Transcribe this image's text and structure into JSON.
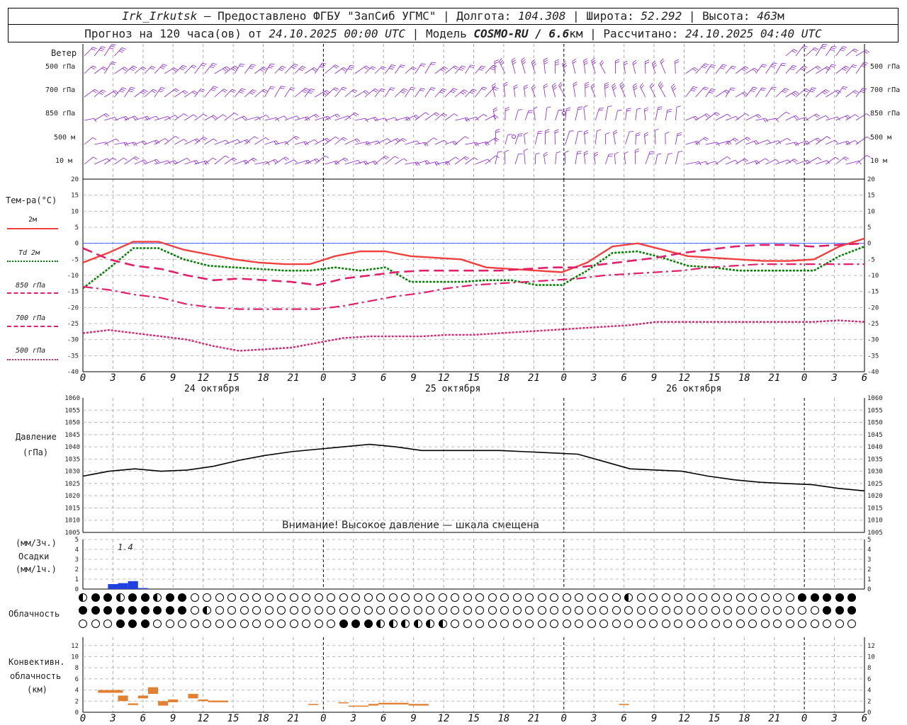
{
  "header": {
    "station": "Irk_Irkutsk",
    "provider": "— Предоставлено ФГБУ \"ЗапСиб УГМС\"",
    "lon_label": "Долгота:",
    "lon": "104.308",
    "lat_label": "Широта:",
    "lat": "52.292",
    "alt_label": "Высота:",
    "alt": "463",
    "alt_unit": "м",
    "forecast_label": "Прогноз на 120 часа(ов) от",
    "forecast_from": "24.10.2025 00:00 UTC",
    "model_label": "Модель",
    "model": "COSMO-RU / 6.6",
    "model_unit": "км",
    "calc_label": "Рассчитано:",
    "calc_time": "24.10.2025 04:40 UTC"
  },
  "wind": {
    "title": "Ветер",
    "levels": [
      "500 гПа",
      "700 гПа",
      "850 гПа",
      "500 м",
      "10 м"
    ]
  },
  "temp": {
    "title": "Тем-ра(°C)",
    "legend": [
      "2м",
      "Td 2м",
      "850 гПа",
      "700 гПа",
      "500 гПа"
    ],
    "colors": {
      "t2m": "#f04040",
      "td2m": "#008000",
      "t850": "#e0206a",
      "t700": "#e0206a",
      "t500": "#e0206a"
    }
  },
  "pressure": {
    "title": "Давление",
    "unit": "(гПа)",
    "warning": "Внимание! Высокое давление — шкала смещена"
  },
  "precip": {
    "unit1": "(мм/3ч.)",
    "title": "Осадки",
    "unit2": "(мм/1ч.)",
    "max_label": "1.4",
    "color": "#2040e0"
  },
  "clouds": {
    "title": "Облачность"
  },
  "conv": {
    "title1": "Конвективн.",
    "title2": "облачность",
    "unit": "(км)",
    "color": "#e08030"
  },
  "axis": {
    "ticks": [
      "0",
      "3",
      "6",
      "9",
      "12",
      "15",
      "18",
      "21",
      "0",
      "3",
      "6",
      "9",
      "12",
      "15",
      "18",
      "21",
      "0",
      "3",
      "6",
      "9",
      "12",
      "15",
      "18",
      "21",
      "0",
      "3",
      "6"
    ],
    "dates": [
      "24 октября",
      "25 октября",
      "26 октября"
    ]
  },
  "chart_data": [
    {
      "type": "line",
      "title": "Тем-ра(°C)",
      "x_hours": [
        0,
        3,
        6,
        9,
        12,
        15,
        18,
        21,
        24,
        27,
        30,
        33,
        36,
        39,
        42,
        45,
        48,
        51,
        54,
        57,
        60,
        63,
        66,
        69,
        72,
        75,
        78
      ],
      "ylim": [
        -40,
        20
      ],
      "series": [
        {
          "name": "2м",
          "values": [
            -6,
            -3,
            0.5,
            0.5,
            -2,
            -3.5,
            -5,
            -6,
            -6.5,
            -6.5,
            -4,
            -2.5,
            -2.5,
            -4,
            -4.5,
            -5,
            -7.5,
            -8,
            -8.5,
            -9,
            -6,
            -1,
            0,
            -2,
            -4,
            -4.5,
            -5,
            -5.5,
            -5.5,
            -5,
            -1,
            1.5
          ]
        },
        {
          "name": "Td 2м",
          "values": [
            -14,
            -8,
            -1.5,
            -1.5,
            -5,
            -7,
            -7.5,
            -8,
            -8.5,
            -8.5,
            -7.5,
            -8.5,
            -7.5,
            -12,
            -12,
            -12,
            -11.5,
            -11.5,
            -13,
            -13,
            -8.5,
            -3,
            -2.5,
            -4.5,
            -7,
            -7.5,
            -8.5,
            -8.5,
            -8.5,
            -8.5,
            -4,
            -1
          ]
        },
        {
          "name": "850 гПа",
          "values": [
            -1.5,
            -5,
            -7,
            -8,
            -10,
            -11.5,
            -11,
            -11.5,
            -12,
            -13,
            -11,
            -10,
            -9,
            -8.5,
            -8.5,
            -8.5,
            -8.5,
            -8,
            -7.5,
            -7.5,
            -6.5,
            -5.5,
            -4.5,
            -3,
            -2,
            -1,
            -0.5,
            -0.5,
            -1,
            -0.5,
            0
          ]
        },
        {
          "name": "700 гПа",
          "values": [
            -13.5,
            -14.5,
            -16,
            -17,
            -19,
            -20,
            -20.5,
            -20.5,
            -20.5,
            -20.5,
            -19.5,
            -18,
            -16.5,
            -15.5,
            -14,
            -13,
            -12.5,
            -12,
            -11.5,
            -11,
            -10,
            -9.5,
            -9,
            -8.5,
            -7.5,
            -7,
            -6.5,
            -6.5,
            -6.5,
            -6.5,
            -6.5
          ]
        },
        {
          "name": "500 гПа",
          "values": [
            -28,
            -27,
            -28,
            -29,
            -30,
            -32,
            -33.5,
            -33,
            -32.5,
            -31,
            -29.5,
            -29,
            -29,
            -29,
            -28.5,
            -28.5,
            -28,
            -27.5,
            -27,
            -26.5,
            -26,
            -25.5,
            -24.5,
            -24.5,
            -24.5,
            -24.5,
            -24.5,
            -24.5,
            -24.5,
            -24,
            -24.5
          ]
        }
      ]
    },
    {
      "type": "line",
      "title": "Давление",
      "ylim": [
        1005,
        1060
      ],
      "series": [
        {
          "name": "Давление",
          "values": [
            1028,
            1030,
            1031,
            1030,
            1030.5,
            1032,
            1034.5,
            1036.5,
            1038,
            1039,
            1040,
            1041,
            1040,
            1038.5,
            1038.5,
            1038.5,
            1038.5,
            1038,
            1037.5,
            1037,
            1034,
            1031,
            1030.5,
            1030,
            1028,
            1026.5,
            1025.5,
            1025,
            1024.5,
            1023,
            1022
          ]
        }
      ]
    },
    {
      "type": "bar",
      "title": "Осадки",
      "ylim": [
        0,
        5
      ],
      "values_by_hour": {
        "2": 0,
        "3": 0.5,
        "4": 0.6,
        "5": 0.8,
        "6": 0.1
      }
    },
    {
      "type": "bar",
      "title": "Конвективн. облачность",
      "ylim": [
        0,
        13
      ],
      "segments_km": [
        [
          1.5,
          4,
          3.5,
          4
        ],
        [
          3.5,
          4.5,
          2,
          3
        ],
        [
          4.5,
          5.5,
          1.3,
          1.6
        ],
        [
          5.5,
          6.5,
          2.5,
          3
        ],
        [
          6.5,
          7.5,
          3.3,
          4.5
        ],
        [
          7.5,
          8.5,
          1.2,
          2
        ],
        [
          8.5,
          9.5,
          1.8,
          2.3
        ],
        [
          10.5,
          11.5,
          2.5,
          3.3
        ],
        [
          11.5,
          12.5,
          2,
          2.3
        ],
        [
          12.5,
          14.5,
          1.8,
          2.1
        ],
        [
          22.5,
          23.5,
          1.3,
          1.5
        ],
        [
          25.5,
          26.5,
          1.6,
          1.8
        ],
        [
          26.5,
          28.5,
          1,
          1.2
        ],
        [
          28.5,
          29.5,
          1.2,
          1.5
        ],
        [
          29.5,
          32.5,
          1.4,
          1.7
        ],
        [
          32.5,
          34.5,
          1.2,
          1.5
        ],
        [
          53.5,
          54.5,
          1.3,
          1.5
        ]
      ]
    }
  ]
}
